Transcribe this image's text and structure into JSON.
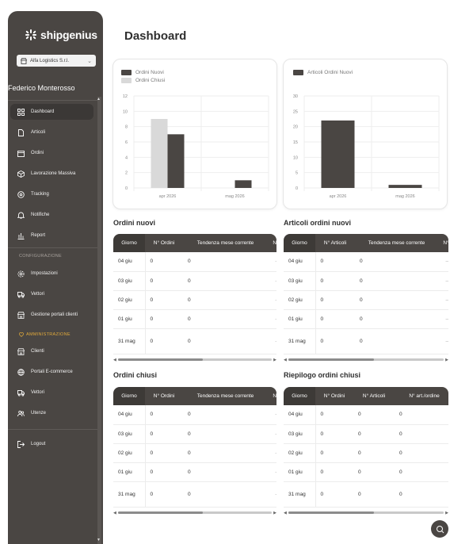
{
  "sidebar": {
    "brand": "shipgenius",
    "company_select": "Alfa Logistics S.r.l.",
    "user_name": "Federico Monterosso",
    "items": [
      {
        "label": "Dashboard",
        "icon": "grid-icon"
      },
      {
        "label": "Articoli",
        "icon": "file-icon"
      },
      {
        "label": "Ordini",
        "icon": "calendar-icon"
      },
      {
        "label": "Lavorazione Massiva",
        "icon": "box-icon"
      },
      {
        "label": "Tracking",
        "icon": "location-icon"
      },
      {
        "label": "Notifiche",
        "icon": "bell-icon"
      },
      {
        "label": "Report",
        "icon": "chart-icon"
      }
    ],
    "config_label": "CONFIGURAZIONE",
    "config_items": [
      {
        "label": "Impostazioni",
        "icon": "gear-icon"
      },
      {
        "label": "Vettori",
        "icon": "truck-icon"
      },
      {
        "label": "Gestione portali clienti",
        "icon": "store-icon"
      }
    ],
    "admin_label": "AMMINISTRAZIONE",
    "admin_items": [
      {
        "label": "Clienti",
        "icon": "store-icon"
      },
      {
        "label": "Portali E-commerce",
        "icon": "globe-icon"
      },
      {
        "label": "Vettori",
        "icon": "truck-icon"
      },
      {
        "label": "Utenze",
        "icon": "users-icon"
      }
    ],
    "logout": "Logout"
  },
  "page_title": "Dashboard",
  "chart_data": [
    {
      "type": "bar",
      "categories": [
        "apr 2026",
        "mag 2026"
      ],
      "series": [
        {
          "name": "Ordini Nuovi",
          "values": [
            7,
            1
          ],
          "color": "#4a4643"
        },
        {
          "name": "Ordini Chiusi",
          "values": [
            9,
            0
          ],
          "color": "#d9d9d9"
        }
      ],
      "yticks": [
        0,
        2,
        4,
        6,
        8,
        10,
        12
      ],
      "ylim": [
        0,
        12
      ],
      "legend": "top-left",
      "grid": true
    },
    {
      "type": "bar",
      "categories": [
        "apr 2026",
        "mag 2026"
      ],
      "series": [
        {
          "name": "Articoli Ordini Nuovi",
          "values": [
            22,
            1
          ],
          "color": "#4a4643"
        }
      ],
      "yticks": [
        0,
        5,
        10,
        15,
        20,
        25,
        30
      ],
      "ylim": [
        0,
        30
      ],
      "legend": "top-left",
      "grid": true
    }
  ],
  "tables": {
    "ordini_nuovi": {
      "title": "Ordini nuovi",
      "headers": [
        "Giorno",
        "N° Ordini",
        "Tendenza mese corrente",
        "N°"
      ],
      "rows": [
        [
          "04 giu",
          "0",
          "0",
          "—"
        ],
        [
          "03 giu",
          "0",
          "0",
          "—"
        ],
        [
          "02 giu",
          "0",
          "0",
          "—"
        ],
        [
          "01 giu",
          "0",
          "0",
          "—"
        ],
        [
          "31 mag",
          "0",
          "0",
          "—"
        ]
      ]
    },
    "articoli_ordini_nuovi": {
      "title": "Articoli ordini nuovi",
      "headers": [
        "Giorno",
        "N° Articoli",
        "Tendenza mese corrente",
        "N°"
      ],
      "rows": [
        [
          "04 giu",
          "0",
          "0",
          "—"
        ],
        [
          "03 giu",
          "0",
          "0",
          "—"
        ],
        [
          "02 giu",
          "0",
          "0",
          "—"
        ],
        [
          "01 giu",
          "0",
          "0",
          "—"
        ],
        [
          "31 mag",
          "0",
          "0",
          "—"
        ]
      ]
    },
    "ordini_chiusi": {
      "title": "Ordini chiusi",
      "headers": [
        "Giorno",
        "N° Ordini",
        "Tendenza mese corrente",
        "N°"
      ],
      "rows": [
        [
          "04 giu",
          "0",
          "0",
          "—"
        ],
        [
          "03 giu",
          "0",
          "0",
          "—"
        ],
        [
          "02 giu",
          "0",
          "0",
          "—"
        ],
        [
          "01 giu",
          "0",
          "0",
          "—"
        ],
        [
          "31 mag",
          "0",
          "0",
          "—"
        ]
      ]
    },
    "riepilogo": {
      "title": "Riepilogo ordini chiusi",
      "headers": [
        "Giorno",
        "N° Ordini",
        "N° Articoli",
        "N° art./ordine"
      ],
      "rows": [
        [
          "04 giu",
          "0",
          "0",
          "0"
        ],
        [
          "03 giu",
          "0",
          "0",
          "0"
        ],
        [
          "02 giu",
          "0",
          "0",
          "0"
        ],
        [
          "01 giu",
          "0",
          "0",
          "0"
        ],
        [
          "31 mag",
          "0",
          "0",
          "0"
        ]
      ]
    }
  }
}
